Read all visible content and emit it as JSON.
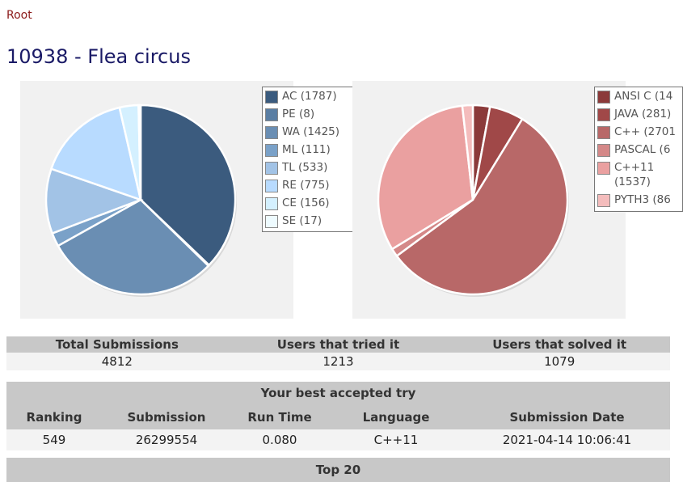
{
  "breadcrumb": "Root",
  "title": "10938 - Flea circus",
  "verdict_chart": {
    "legend": [
      {
        "label": "AC (1787)",
        "color": "#3b5b7e"
      },
      {
        "label": "PE (8)",
        "color": "#5a7ea3"
      },
      {
        "label": "WA (1425)",
        "color": "#6a8eb3"
      },
      {
        "label": "ML (111)",
        "color": "#7aa1c8"
      },
      {
        "label": "TL (533)",
        "color": "#a2c3e6"
      },
      {
        "label": "RE (775)",
        "color": "#b8dbff"
      },
      {
        "label": "CE (156)",
        "color": "#d4f0ff"
      },
      {
        "label": "SE (17)",
        "color": "#eefbff"
      }
    ]
  },
  "language_chart": {
    "legend": [
      {
        "label": "ANSI C (14",
        "color": "#8b3a3a"
      },
      {
        "label": "JAVA (281)",
        "color": "#a04848"
      },
      {
        "label": "C++ (2701",
        "color": "#b86868"
      },
      {
        "label": "PASCAL (6",
        "color": "#d48888"
      },
      {
        "label": "C++11 (1537)",
        "color": "#eaa0a0"
      },
      {
        "label": "PYTH3 (86",
        "color": "#f4bcbc"
      }
    ]
  },
  "chart_data": [
    {
      "type": "pie",
      "title": "",
      "slices": [
        {
          "name": "AC",
          "value": 1787,
          "color": "#3b5b7e"
        },
        {
          "name": "PE",
          "value": 8,
          "color": "#5a7ea3"
        },
        {
          "name": "WA",
          "value": 1425,
          "color": "#6a8eb3"
        },
        {
          "name": "ML",
          "value": 111,
          "color": "#7aa1c8"
        },
        {
          "name": "TL",
          "value": 533,
          "color": "#a2c3e6"
        },
        {
          "name": "RE",
          "value": 775,
          "color": "#b8dbff"
        },
        {
          "name": "CE",
          "value": 156,
          "color": "#d4f0ff"
        },
        {
          "name": "SE",
          "value": 17,
          "color": "#eefbff"
        }
      ],
      "legend": "right"
    },
    {
      "type": "pie",
      "title": "",
      "slices": [
        {
          "name": "ANSI C",
          "value": 140,
          "color": "#8b3a3a"
        },
        {
          "name": "JAVA",
          "value": 281,
          "color": "#a04848"
        },
        {
          "name": "C++",
          "value": 2701,
          "color": "#b86868"
        },
        {
          "name": "PASCAL",
          "value": 67,
          "color": "#d48888"
        },
        {
          "name": "C++11",
          "value": 1537,
          "color": "#eaa0a0"
        },
        {
          "name": "PYTH3",
          "value": 86,
          "color": "#f4bcbc"
        }
      ],
      "legend": "right"
    }
  ],
  "stats": {
    "headers": [
      "Total Submissions",
      "Users that tried it",
      "Users that solved it"
    ],
    "values": [
      "4812",
      "1213",
      "1079"
    ]
  },
  "best": {
    "heading": "Your best accepted try",
    "headers": [
      "Ranking",
      "Submission",
      "Run Time",
      "Language",
      "Submission Date"
    ],
    "values": [
      "549",
      "26299554",
      "0.080",
      "C++11",
      "2021-04-14 10:06:41"
    ]
  },
  "top20": "Top 20"
}
